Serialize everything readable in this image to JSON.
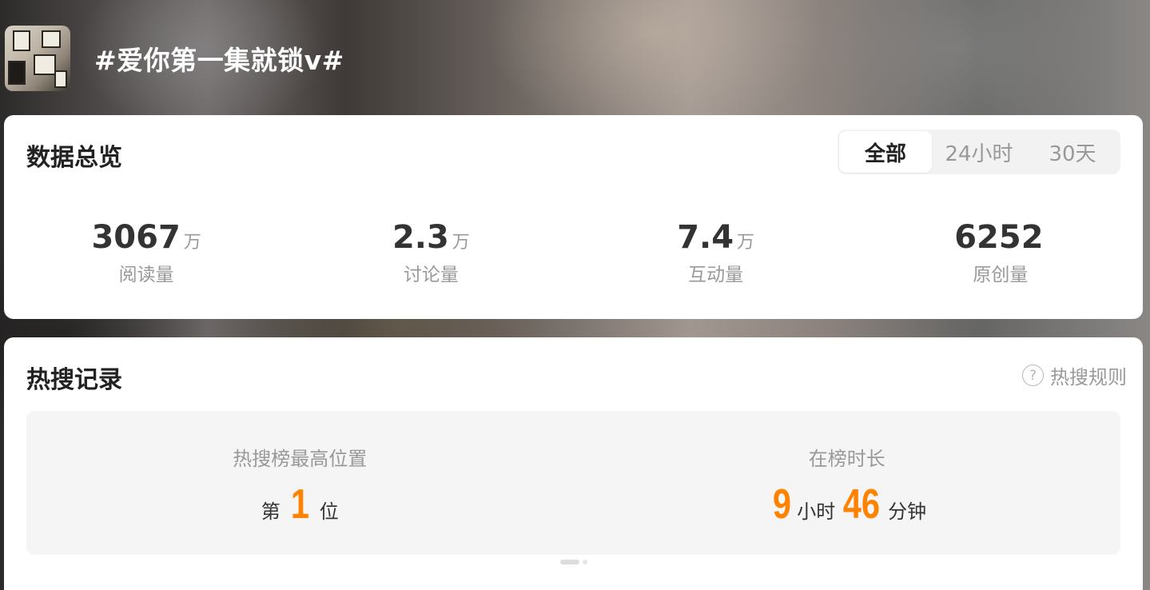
{
  "header": {
    "topic_title": "#爱你第一集就锁v#"
  },
  "overview": {
    "title": "数据总览",
    "tabs": [
      {
        "label": "全部",
        "active": true
      },
      {
        "label": "24小时",
        "active": false
      },
      {
        "label": "30天",
        "active": false
      }
    ],
    "stats": [
      {
        "value": "3067",
        "unit": "万",
        "label": "阅读量"
      },
      {
        "value": "2.3",
        "unit": "万",
        "label": "讨论量"
      },
      {
        "value": "7.4",
        "unit": "万",
        "label": "互动量"
      },
      {
        "value": "6252",
        "unit": "",
        "label": "原创量"
      }
    ]
  },
  "hot_search": {
    "title": "热搜记录",
    "rules_label": "热搜规则",
    "rules_icon": "help-circle-icon",
    "highest_position": {
      "label": "热搜榜最高位置",
      "prefix": "第",
      "value": "1",
      "suffix": "位"
    },
    "duration": {
      "label": "在榜时长",
      "hours": "9",
      "hours_unit": "小时",
      "minutes": "46",
      "minutes_unit": "分钟"
    },
    "carousel": {
      "pages": 2,
      "active_page": 1
    }
  },
  "colors": {
    "accent": "#ff8200",
    "card_bg": "#ffffff",
    "panel_bg": "#f5f5f5"
  }
}
